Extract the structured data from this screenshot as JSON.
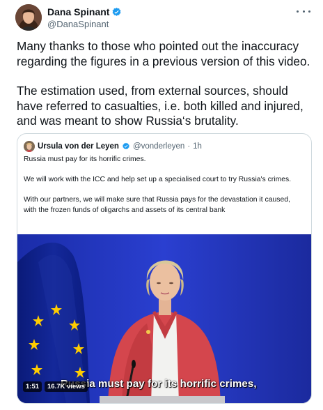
{
  "tweet": {
    "author_name": "Dana Spinant",
    "author_handle": "@DanaSpinant",
    "paragraph_1": "Many thanks to those who pointed out the inaccuracy regarding the figures in a previous version of this video.",
    "paragraph_2": "The estimation used, from external sources, should have referred to casualties, i.e. both killed and injured, and was meant to show Russia‘s brutality."
  },
  "quote": {
    "author_name": "Ursula von der Leyen",
    "author_handle": "@vonderleyen",
    "separator": "·",
    "time": "1h",
    "paragraph_1": "Russia must pay for its horrific crimes.",
    "paragraph_2": "We will work with the ICC and help set up a specialised court to try Russia's crimes.",
    "paragraph_3": "With our partners, we will make sure that Russia pays for the devastation it caused, with the frozen funds of oligarchs and assets of its central bank"
  },
  "video": {
    "duration": "1:51",
    "views": "16.7K views",
    "subtitle": "Russia must pay for its horrific crimes,"
  },
  "icons": {
    "verified": "verified-badge-icon",
    "more": "more-options-icon"
  },
  "colors": {
    "verified_blue": "#1d9bf0",
    "eu_blue": "#003399",
    "eu_star": "#ffcc00",
    "jacket": "#d4464d"
  }
}
